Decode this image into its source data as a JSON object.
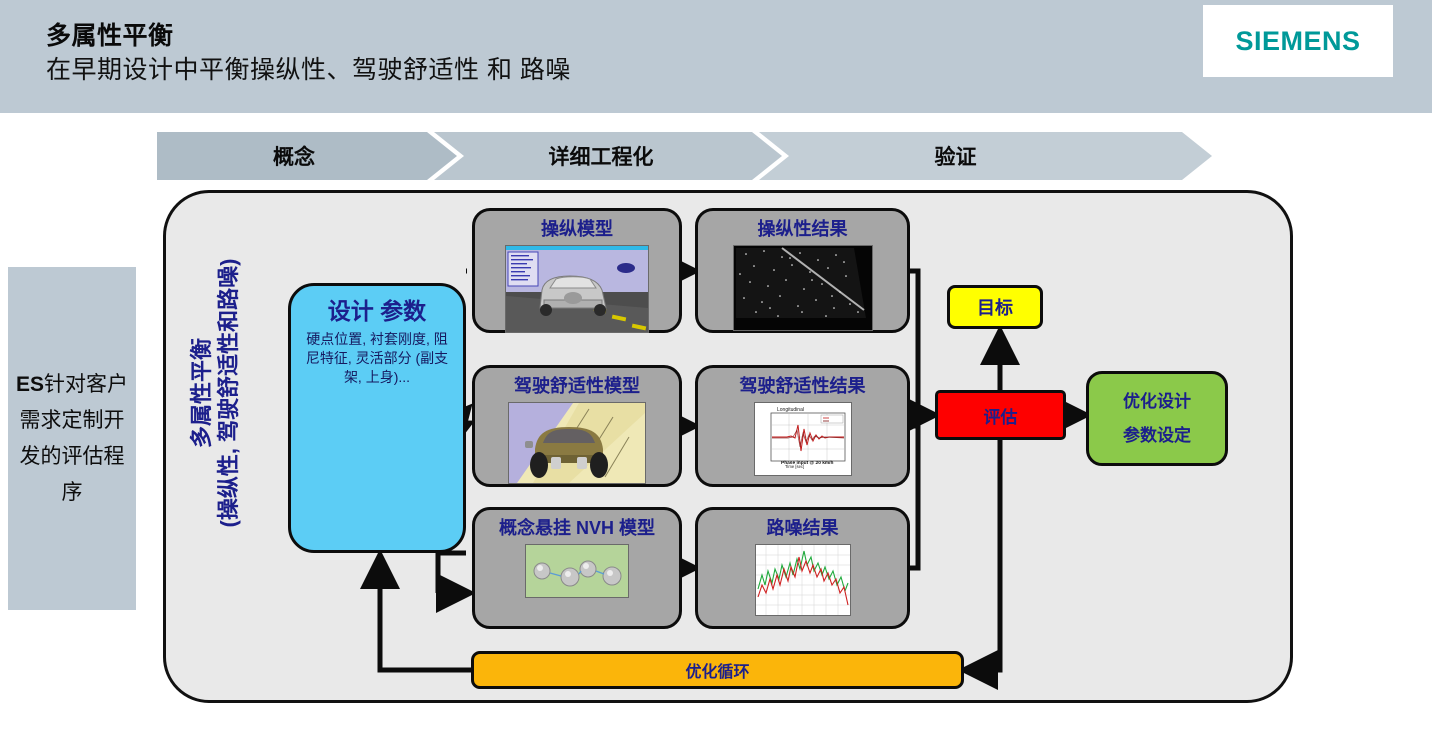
{
  "header": {
    "title": "多属性平衡",
    "subtitle": "在早期设计中平衡操纵性、驾驶舒适性 和 路噪",
    "logo": "SIEMENS",
    "logo_color": "#009999",
    "background_color": "#bdc9d3"
  },
  "phases": [
    {
      "label": "概念",
      "color": "#aebcc6"
    },
    {
      "label": "详细工程化",
      "color": "#bac6cf"
    },
    {
      "label": "验证",
      "color": "#c3ced6"
    }
  ],
  "left_note": {
    "bold_prefix": "ES",
    "text": "针对客户需求定制开发的评估程序",
    "full_text": "ES针对客户需求定制开发的评估程序",
    "background_color": "#bdc9d3"
  },
  "panel": {
    "vertical_label_line1": "多属性平衡",
    "vertical_label_line2": "(操纵性, 驾驶舒适性和路噪)",
    "vertical_label_color": "#1c1f8c",
    "background_color": "#e9e9e9"
  },
  "design_params": {
    "title": "设计 参数",
    "body": "硬点位置, 衬套刚度, 阻尼特征, 灵活部分 (副支架, 上身)...",
    "color": "#5ccdf5"
  },
  "rows": [
    {
      "model": {
        "title": "操纵模型",
        "thumb": "vehicle-mesh-road-thumb"
      },
      "result": {
        "title": "操纵性结果",
        "thumb": "dark-scatter-plot-thumb"
      }
    },
    {
      "model": {
        "title": "驾驶舒适性模型",
        "thumb": "vehicle-on-slope-thumb"
      },
      "result": {
        "title": "驾驶舒适性结果",
        "thumb": "longitudinal-time-signal-thumb"
      }
    },
    {
      "model": {
        "title": "概念悬挂 NVH 模型",
        "thumb": "suspension-modes-thumb"
      },
      "result": {
        "title": "路噪结果",
        "thumb": "red-green-spectrum-thumb"
      }
    }
  ],
  "target": {
    "label": "目标",
    "color": "#ffff00"
  },
  "evaluation": {
    "label": "评估",
    "color": "#fe0000"
  },
  "optimized_design": {
    "line1": "优化设计",
    "line2": "参数设定",
    "color": "#8bc94a"
  },
  "optimization_loop": {
    "label": "优化循环",
    "color": "#fbb50a"
  }
}
